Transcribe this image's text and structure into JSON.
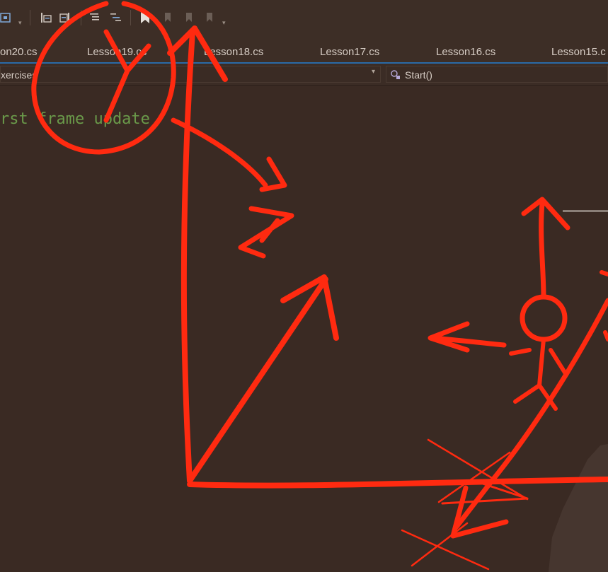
{
  "toolbar": {
    "icons": [
      "home-icon",
      "indent-icon",
      "outdent-icon",
      "comment-icon",
      "uncomment-icon",
      "bookmark-icon",
      "prev-bookmark-icon",
      "next-bookmark-icon",
      "clear-bookmark-icon"
    ],
    "overflow_glyph": "▾"
  },
  "tabs": [
    {
      "label": "on20.cs"
    },
    {
      "label": "Lesson19.cs"
    },
    {
      "label": "Lesson18.cs"
    },
    {
      "label": "Lesson17.cs"
    },
    {
      "label": "Lesson16.cs"
    },
    {
      "label": "Lesson15.c"
    }
  ],
  "navbar": {
    "class_text": "xercises",
    "member_text": "Start()",
    "member_icon": "method-icon",
    "caret": "▾"
  },
  "editor": {
    "comment_text": "rst frame update"
  },
  "colors": {
    "background": "#3a2a23",
    "tab_text": "#d6ccc4",
    "comment": "#6a9a4a",
    "annotation": "#ff2a10",
    "accent": "#2a6aa8"
  }
}
